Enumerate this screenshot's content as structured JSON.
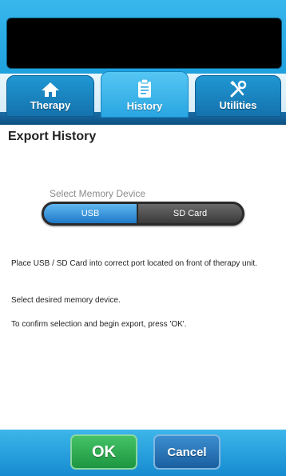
{
  "tabs": [
    {
      "label": "Therapy",
      "icon": "home-icon",
      "active": false
    },
    {
      "label": "History",
      "icon": "clipboard-icon",
      "active": true
    },
    {
      "label": "Utilities",
      "icon": "tools-icon",
      "active": false
    }
  ],
  "section_title": "Export History",
  "memory": {
    "label": "Select Memory Device",
    "options": [
      "USB",
      "SD Card"
    ],
    "selected": "USB"
  },
  "instructions": [
    "Place USB / SD Card into correct port located on front of therapy unit.",
    "Select desired memory device.",
    "To confirm selection and begin export, press 'OK'."
  ],
  "buttons": {
    "ok": "OK",
    "cancel": "Cancel"
  },
  "colors": {
    "accent": "#1fa1de",
    "ok_green": "#2aa84d",
    "selected_blue": "#2a86d3"
  }
}
